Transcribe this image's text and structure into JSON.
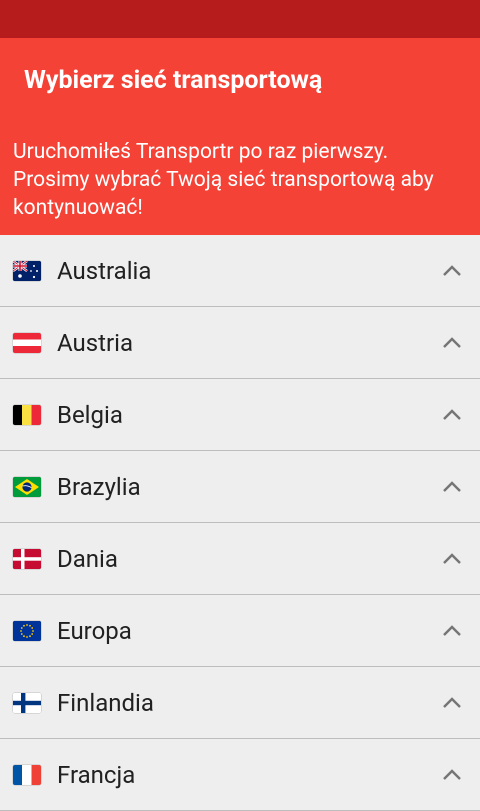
{
  "header": {
    "title": "Wybierz sieć transportową",
    "subtitle": "Uruchomiłeś Transportr po raz pierwszy. Prosimy wybrać Twoją sieć transportową aby kontynuować!"
  },
  "colors": {
    "status_bar": "#B71C1C",
    "app_bar": "#F44336",
    "list_background": "#EEEEEE"
  },
  "countries": [
    {
      "name": "Australia",
      "flag": "australia-flag-icon"
    },
    {
      "name": "Austria",
      "flag": "austria-flag-icon"
    },
    {
      "name": "Belgia",
      "flag": "belgium-flag-icon"
    },
    {
      "name": "Brazylia",
      "flag": "brazil-flag-icon"
    },
    {
      "name": "Dania",
      "flag": "denmark-flag-icon"
    },
    {
      "name": "Europa",
      "flag": "eu-flag-icon"
    },
    {
      "name": "Finlandia",
      "flag": "finland-flag-icon"
    },
    {
      "name": "Francja",
      "flag": "france-flag-icon"
    }
  ]
}
